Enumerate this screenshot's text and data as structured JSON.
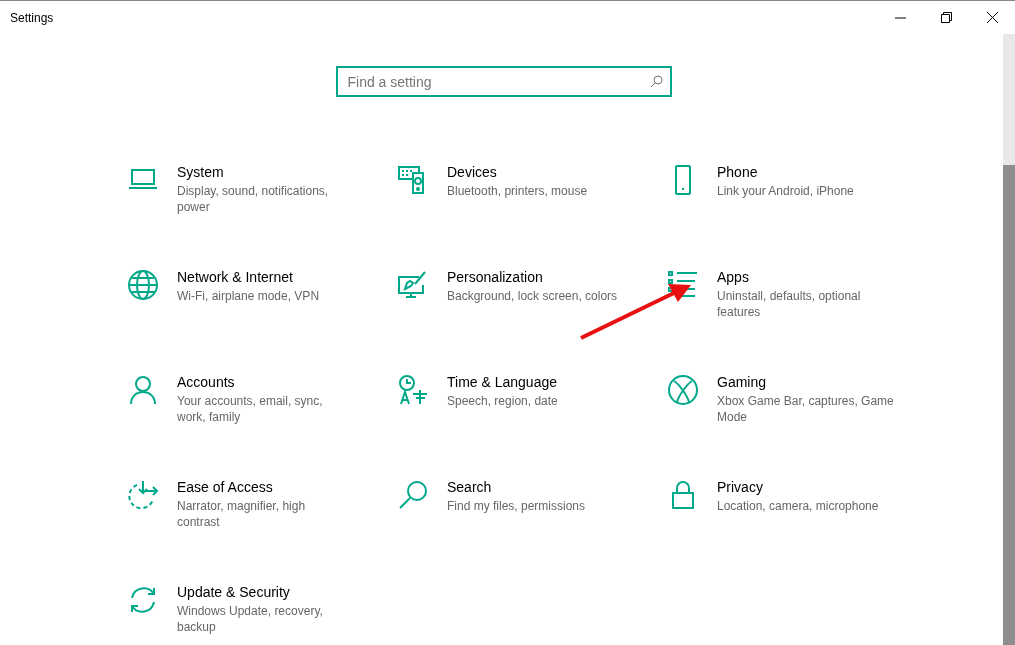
{
  "window": {
    "title": "Settings"
  },
  "search": {
    "placeholder": "Find a setting"
  },
  "categories": [
    {
      "title": "System",
      "description_lines": [
        "Display, sound, notifications,",
        "power"
      ]
    },
    {
      "title": "Devices",
      "description_lines": [
        "Bluetooth, printers, mouse"
      ]
    },
    {
      "title": "Phone",
      "description_lines": [
        "Link your Android, iPhone"
      ]
    },
    {
      "title": "Network & Internet",
      "description_lines": [
        "Wi-Fi, airplane mode, VPN"
      ]
    },
    {
      "title": "Personalization",
      "description_lines": [
        "Background, lock screen, colors"
      ]
    },
    {
      "title": "Apps",
      "description_lines": [
        "Uninstall, defaults, optional",
        "features"
      ]
    },
    {
      "title": "Accounts",
      "description_lines": [
        "Your accounts, email, sync,",
        "work, family"
      ]
    },
    {
      "title": "Time & Language",
      "description_lines": [
        "Speech, region, date"
      ]
    },
    {
      "title": "Gaming",
      "description_lines": [
        "Xbox Game Bar, captures, Game",
        "Mode"
      ]
    },
    {
      "title": "Ease of Access",
      "description_lines": [
        "Narrator, magnifier, high",
        "contrast"
      ]
    },
    {
      "title": "Search",
      "description_lines": [
        "Find my files, permissions"
      ]
    },
    {
      "title": "Privacy",
      "description_lines": [
        "Location, camera, microphone"
      ]
    },
    {
      "title": "Update & Security",
      "description_lines": [
        "Windows Update, recovery,",
        "backup"
      ]
    }
  ]
}
